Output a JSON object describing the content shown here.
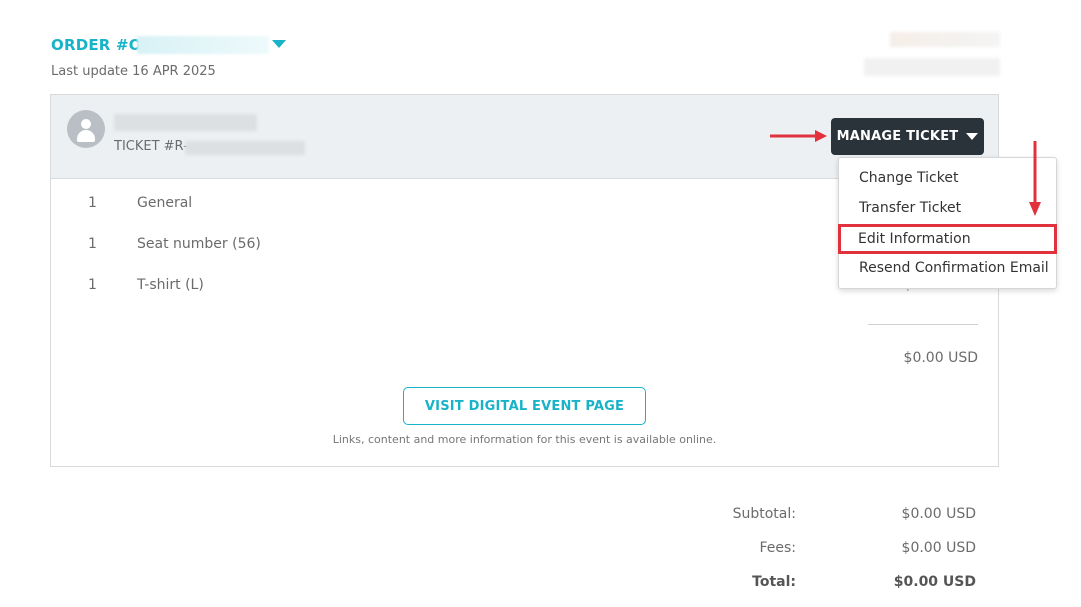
{
  "header": {
    "order_prefix": "ORDER #O-",
    "last_update": "Last update 16 APR 2025"
  },
  "ticket": {
    "ticket_prefix": "TICKET #R-",
    "manage_button": "MANAGE TICKET"
  },
  "line_items": [
    {
      "qty": "1",
      "description": "General",
      "price": ""
    },
    {
      "qty": "1",
      "description": "Seat number (56)",
      "price": ""
    },
    {
      "qty": "1",
      "description": "T-shirt (L)",
      "price": "$0.00 USD"
    }
  ],
  "item_total": "$0.00 USD",
  "digital_event": {
    "button_label": "VISIT DIGITAL EVENT PAGE",
    "note": "Links, content and more information for this event is available online."
  },
  "manage_menu": {
    "items": [
      {
        "label": "Change Ticket",
        "highlighted": false
      },
      {
        "label": "Transfer Ticket",
        "highlighted": false
      },
      {
        "label": "Edit Information",
        "highlighted": true
      },
      {
        "label": "Resend Confirmation Email",
        "highlighted": false
      }
    ]
  },
  "totals": {
    "subtotal_label": "Subtotal:",
    "subtotal_value": "$0.00 USD",
    "fees_label": "Fees:",
    "fees_value": "$0.00 USD",
    "total_label": "Total:",
    "total_value": "$0.00 USD"
  },
  "colors": {
    "accent": "#18b3c8",
    "dark_button": "#2a323a",
    "annotation": "#e0313c"
  },
  "icons": {
    "avatar": "user-avatar-icon",
    "order_dropdown": "caret-down-icon",
    "manage_dropdown": "caret-down-icon"
  }
}
